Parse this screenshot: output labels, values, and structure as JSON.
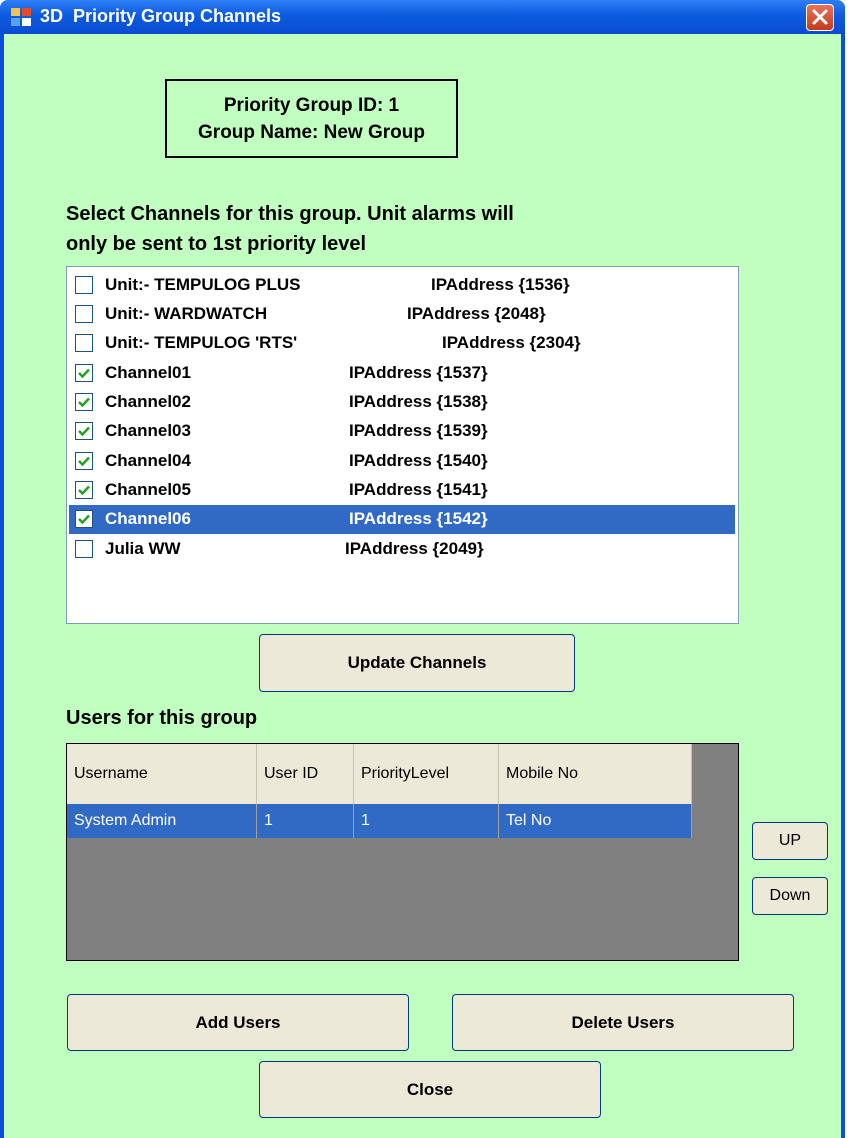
{
  "window": {
    "title": "3D  Priority Group Channels"
  },
  "group": {
    "id_text": "Priority Group ID: 1",
    "name_text": "Group Name: New Group"
  },
  "instructions": {
    "line1": "Select Channels for this group.  Unit alarms will",
    "line2": "only be sent to 1st priority level"
  },
  "channels": [
    {
      "name": "Unit:- TEMPULOG PLUS",
      "ip": "IPAddress {1536}",
      "checked": false,
      "selected": false
    },
    {
      "name": "Unit:- WARDWATCH",
      "ip": "IPAddress {2048}",
      "checked": false,
      "selected": false
    },
    {
      "name": "Unit:- TEMPULOG 'RTS'",
      "ip": "IPAddress {2304}",
      "checked": false,
      "selected": false
    },
    {
      "name": "Channel01",
      "ip": "IPAddress {1537}",
      "checked": true,
      "selected": false
    },
    {
      "name": "Channel02",
      "ip": "IPAddress {1538}",
      "checked": true,
      "selected": false
    },
    {
      "name": "Channel03",
      "ip": "IPAddress {1539}",
      "checked": true,
      "selected": false
    },
    {
      "name": "Channel04",
      "ip": "IPAddress {1540}",
      "checked": true,
      "selected": false
    },
    {
      "name": "Channel05",
      "ip": "IPAddress {1541}",
      "checked": true,
      "selected": false
    },
    {
      "name": "Channel06",
      "ip": "IPAddress {1542}",
      "checked": true,
      "selected": true
    },
    {
      "name": "Julia WW",
      "ip": "IPAddress {2049}",
      "checked": false,
      "selected": false
    }
  ],
  "buttons": {
    "update": "Update Channels",
    "add_users": "Add Users",
    "delete_users": "Delete Users",
    "close": "Close",
    "up": "UP",
    "down": "Down"
  },
  "users": {
    "label": "Users for this group",
    "columns": [
      "Username",
      "User ID",
      "PriorityLevel",
      "Mobile No"
    ],
    "rows": [
      {
        "cells": [
          "System Admin",
          "1",
          "1",
          "Tel No"
        ],
        "selected": true
      }
    ]
  }
}
